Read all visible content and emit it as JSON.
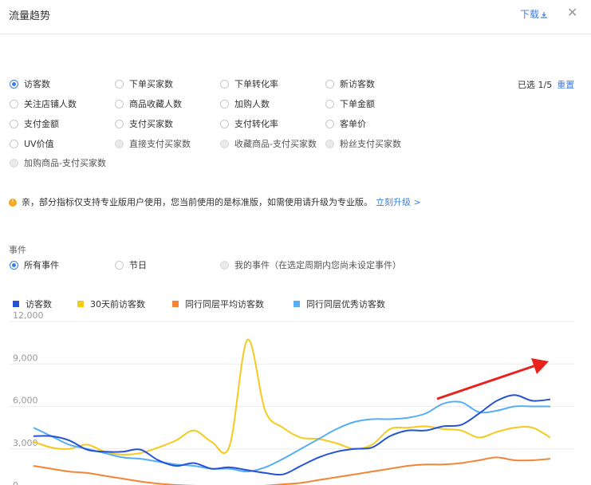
{
  "header": {
    "title": "流量趋势",
    "download": "下载",
    "download_icon": "download-icon",
    "close_icon": "close-icon"
  },
  "metrics": {
    "options": [
      {
        "label": "访客数",
        "state": "checked"
      },
      {
        "label": "下单买家数",
        "state": "unchecked"
      },
      {
        "label": "下单转化率",
        "state": "unchecked"
      },
      {
        "label": "新访客数",
        "state": "unchecked"
      },
      {
        "label": "关注店铺人数",
        "state": "unchecked"
      },
      {
        "label": "商品收藏人数",
        "state": "unchecked"
      },
      {
        "label": "加购人数",
        "state": "unchecked"
      },
      {
        "label": "下单金额",
        "state": "unchecked"
      },
      {
        "label": "支付金额",
        "state": "unchecked"
      },
      {
        "label": "支付买家数",
        "state": "unchecked"
      },
      {
        "label": "支付转化率",
        "state": "unchecked"
      },
      {
        "label": "客单价",
        "state": "unchecked"
      },
      {
        "label": "UV价值",
        "state": "unchecked"
      },
      {
        "label": "直接支付买家数",
        "state": "disabled"
      },
      {
        "label": "收藏商品-支付买家数",
        "state": "disabled"
      },
      {
        "label": "粉丝支付买家数",
        "state": "disabled"
      },
      {
        "label": "加购商品-支付买家数",
        "state": "disabled"
      }
    ],
    "selected_text": "已选 1/5",
    "reset": "重置"
  },
  "notice": {
    "text": "亲，部分指标仅支持专业版用户使用，您当前使用的是标准版，如需使用请升级为专业版。",
    "upgrade": "立刻升级 >"
  },
  "events": {
    "label": "事件",
    "options": [
      {
        "label": "所有事件",
        "state": "checked"
      },
      {
        "label": "节日",
        "state": "unchecked"
      },
      {
        "label": "我的事件（在选定周期内您尚未设定事件）",
        "state": "disabled"
      }
    ]
  },
  "colors": {
    "accent": "#3d7ee6",
    "warning": "#f5a623",
    "annotation_arrow": "#e8231e"
  },
  "chart_data": {
    "type": "line",
    "title": "",
    "xlabel": "",
    "ylabel": "",
    "ylim": [
      0,
      12000
    ],
    "yticks": [
      0,
      3000,
      6000,
      9000,
      12000
    ],
    "ytick_labels": [
      "0",
      "3,000",
      "6,000",
      "9,000",
      "12,000"
    ],
    "grid": true,
    "legend_placement": "top-left",
    "x": [
      1,
      2,
      3,
      4,
      5,
      6,
      7,
      8,
      9,
      10,
      11,
      12,
      13,
      14,
      15,
      16,
      17,
      18,
      19,
      20,
      21,
      22,
      23,
      24,
      25,
      26,
      27,
      28,
      29,
      30
    ],
    "series": [
      {
        "name": "访客数",
        "color": "#2553d4",
        "values": [
          3900,
          3900,
          3600,
          2950,
          2800,
          2800,
          2950,
          2200,
          1800,
          2000,
          1600,
          1700,
          1500,
          1300,
          1200,
          1800,
          2400,
          2800,
          3000,
          3100,
          3900,
          4300,
          4300,
          4600,
          4700,
          5500,
          6400,
          6800,
          6400,
          6500
        ]
      },
      {
        "name": "30天前访客数",
        "color": "#f5ca1d",
        "values": [
          3500,
          3100,
          3000,
          3300,
          2800,
          2600,
          2700,
          3100,
          3600,
          4300,
          3500,
          3200,
          10700,
          5700,
          4500,
          3800,
          3700,
          3400,
          3000,
          3300,
          4400,
          4500,
          4600,
          4400,
          4300,
          3800,
          4200,
          4500,
          4500,
          3800
        ]
      },
      {
        "name": "同行同层平均访客数",
        "color": "#f58434",
        "values": [
          1800,
          1600,
          1400,
          1300,
          1100,
          900,
          700,
          550,
          450,
          400,
          350,
          300,
          300,
          400,
          500,
          600,
          800,
          1000,
          1200,
          1400,
          1600,
          1800,
          1900,
          1900,
          2000,
          2200,
          2400,
          2200,
          2200,
          2300
        ]
      },
      {
        "name": "同行同层优秀访客数",
        "color": "#56aef5",
        "values": [
          4500,
          3900,
          3300,
          3000,
          2700,
          2400,
          2300,
          2100,
          1900,
          1800,
          1600,
          1600,
          1400,
          1700,
          2300,
          3000,
          3700,
          4400,
          4900,
          5100,
          5100,
          5200,
          5500,
          6200,
          6300,
          5600,
          5700,
          6000,
          6000,
          6000
        ]
      }
    ],
    "annotation": "red arrow pointing up-right"
  }
}
